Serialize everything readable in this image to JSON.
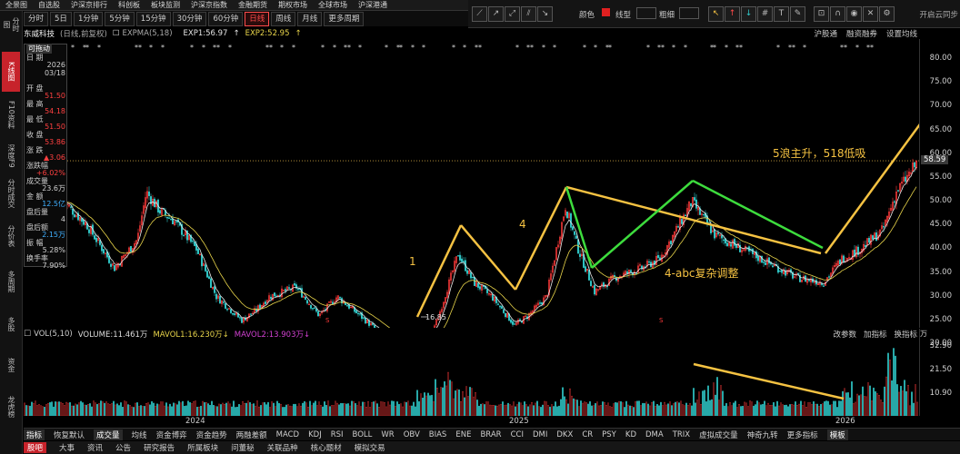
{
  "top_menu": [
    "全景图",
    "自选股",
    "沪深京排行",
    "科创板",
    "板块监测",
    "沪深京指数",
    "金融期货",
    "期权市场",
    "全球市场",
    "沪深港通"
  ],
  "periods": [
    {
      "label": "分时",
      "active": false
    },
    {
      "label": "5日",
      "active": false
    },
    {
      "label": "1分钟",
      "active": false
    },
    {
      "label": "5分钟",
      "active": false
    },
    {
      "label": "15分钟",
      "active": false
    },
    {
      "label": "30分钟",
      "active": false
    },
    {
      "label": "60分钟",
      "active": false
    },
    {
      "label": "日线",
      "active": true
    },
    {
      "label": "周线",
      "active": false
    },
    {
      "label": "月线",
      "active": false
    },
    {
      "label": "更多周期",
      "active": false
    }
  ],
  "toolbar": {
    "color_label": "颜色",
    "line_type_label": "线型",
    "thickness_label": "粗细",
    "open_cloud": "开启云同步"
  },
  "sidebar": [
    {
      "label": "分时图",
      "active": false
    },
    {
      "label": "K线图",
      "active": true
    },
    {
      "label": "F10资料",
      "active": false
    },
    {
      "label": "深度F9",
      "active": false
    },
    {
      "label": "分时成交",
      "active": false
    },
    {
      "label": "分价表",
      "active": false
    },
    {
      "label": "多周期",
      "active": false
    },
    {
      "label": "多股",
      "active": false
    },
    {
      "label": "资金",
      "active": false
    },
    {
      "label": "龙虎榜",
      "active": false
    }
  ],
  "header": {
    "stock_name": "东威科技",
    "chart_mode": "(日线,前复权)",
    "indicator": "EXPMA(5,18)",
    "exp1": "EXP1:56.97",
    "exp2": "EXP2:52.95",
    "right_links": [
      "沪股通",
      "融资融券",
      "设置均线"
    ]
  },
  "info_panel": {
    "drag_hint": "可拖动",
    "rows": [
      {
        "label": "日 期",
        "value": "2026",
        "color": "#d0d0d0"
      },
      {
        "label": "",
        "value": "03/18",
        "color": "#d0d0d0"
      },
      {
        "label": "开 盘",
        "value": "51.50",
        "color": "#ff4040"
      },
      {
        "label": "最 高",
        "value": "54.18",
        "color": "#ff4040"
      },
      {
        "label": "最 低",
        "value": "51.50",
        "color": "#ff4040"
      },
      {
        "label": "收 盘",
        "value": "53.86",
        "color": "#ff4040"
      },
      {
        "label": "涨 跌",
        "value": "▲3.06",
        "color": "#ff4040"
      },
      {
        "label": "涨跌幅",
        "value": "+6.02%",
        "color": "#ff4040"
      },
      {
        "label": "成交量",
        "value": "23.6万",
        "color": "#d0d0d0"
      },
      {
        "label": "金 额",
        "value": "12.5亿",
        "color": "#3fb0ff"
      },
      {
        "label": "盘后量",
        "value": "4",
        "color": "#d0d0d0"
      },
      {
        "label": "盘后额",
        "value": "2.15万",
        "color": "#3fb0ff"
      },
      {
        "label": "振 幅",
        "value": "5.28%",
        "color": "#d0d0d0"
      },
      {
        "label": "换手率",
        "value": "7.90%",
        "color": "#d0d0d0"
      }
    ]
  },
  "price_axis": {
    "labels": [
      "80.00",
      "75.00",
      "70.00",
      "65.00",
      "60.00",
      "55.00",
      "50.00",
      "45.00",
      "40.00",
      "35.00",
      "30.00",
      "25.00",
      "20.00"
    ],
    "current": "58.59"
  },
  "annotations": {
    "wave1": "1",
    "wave4": "4",
    "wave5": "5浪主升，518低吸",
    "abc": "4-abc复杂调整",
    "low_price": "16.85"
  },
  "volume": {
    "title": "VOL(5,10)",
    "volume": "VOLUME:11.461万",
    "mavol1": "MAVOL1:16.230万",
    "mavol2": "MAVOL2:13.903万",
    "right_links": [
      "改参数",
      "加指标",
      "换指标"
    ],
    "axis": [
      "32.90",
      "21.50",
      "10.90"
    ],
    "unit": "万"
  },
  "years": [
    "2024",
    "2025",
    "2026"
  ],
  "indicator_tabs": [
    "指标",
    "恢复默认",
    "成交量",
    "均线",
    "资金博弈",
    "资金趋势",
    "两融差额",
    "MACD",
    "KDJ",
    "RSI",
    "BOLL",
    "WR",
    "OBV",
    "BIAS",
    "ENE",
    "BRAR",
    "CCI",
    "DMI",
    "DKX",
    "CR",
    "PSY",
    "KD",
    "DMA",
    "TRIX",
    "虚拟成交量",
    "神奇九转",
    "更多指标",
    "模板"
  ],
  "bottom_tabs": [
    "股吧",
    "大事",
    "资讯",
    "公告",
    "研究报告",
    "所属板块",
    "问董秘",
    "关联品种",
    "核心题材",
    "模拟交易"
  ],
  "colors": {
    "up": "#ff3b3b",
    "down": "#30c8c8",
    "wave": "#f5c242",
    "abc": "#3ddc3d",
    "ema1": "#e6e6e6",
    "ema2": "#e8d44a"
  }
}
